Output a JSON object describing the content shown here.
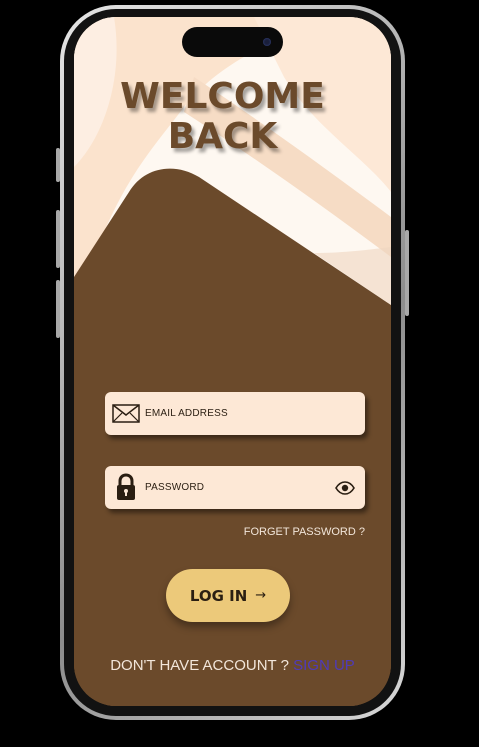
{
  "header": {
    "title_line1": "WELCOME",
    "title_line2": "BACK"
  },
  "form": {
    "email_label": "EMAIL ADDRESS",
    "password_label": "PASSWORD",
    "forget_password": "FORGET PASSWORD ?",
    "login_label": "LOG IN",
    "login_arrow": "→"
  },
  "footer": {
    "prompt": "DON'T HAVE ACCOUNT ?",
    "signup_label": "SIGN UP"
  },
  "icons": {
    "email": "envelope-icon",
    "password": "lock-icon",
    "visibility": "eye-icon",
    "login": "arrow-right-icon"
  },
  "colors": {
    "brown": "#6b4a2b",
    "cream": "#fde8d6",
    "light_cream": "#fef8f1",
    "peach": "#f3dcc8",
    "button_gold": "#ecc97a",
    "link_purple": "#4f3bb8"
  }
}
